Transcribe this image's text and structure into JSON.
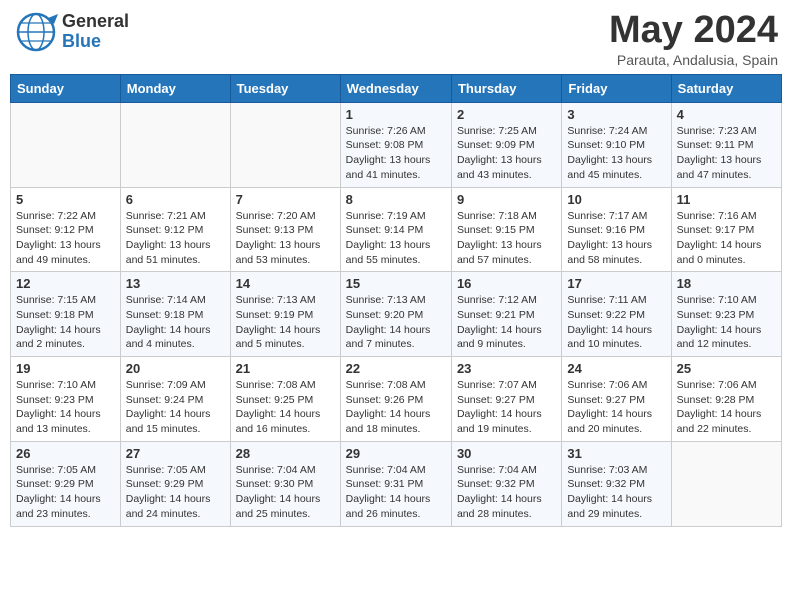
{
  "header": {
    "logo_general": "General",
    "logo_blue": "Blue",
    "month_title": "May 2024",
    "subtitle": "Parauta, Andalusia, Spain"
  },
  "weekdays": [
    "Sunday",
    "Monday",
    "Tuesday",
    "Wednesday",
    "Thursday",
    "Friday",
    "Saturday"
  ],
  "weeks": [
    [
      {
        "day": "",
        "info": ""
      },
      {
        "day": "",
        "info": ""
      },
      {
        "day": "",
        "info": ""
      },
      {
        "day": "1",
        "info": "Sunrise: 7:26 AM\nSunset: 9:08 PM\nDaylight: 13 hours\nand 41 minutes."
      },
      {
        "day": "2",
        "info": "Sunrise: 7:25 AM\nSunset: 9:09 PM\nDaylight: 13 hours\nand 43 minutes."
      },
      {
        "day": "3",
        "info": "Sunrise: 7:24 AM\nSunset: 9:10 PM\nDaylight: 13 hours\nand 45 minutes."
      },
      {
        "day": "4",
        "info": "Sunrise: 7:23 AM\nSunset: 9:11 PM\nDaylight: 13 hours\nand 47 minutes."
      }
    ],
    [
      {
        "day": "5",
        "info": "Sunrise: 7:22 AM\nSunset: 9:12 PM\nDaylight: 13 hours\nand 49 minutes."
      },
      {
        "day": "6",
        "info": "Sunrise: 7:21 AM\nSunset: 9:12 PM\nDaylight: 13 hours\nand 51 minutes."
      },
      {
        "day": "7",
        "info": "Sunrise: 7:20 AM\nSunset: 9:13 PM\nDaylight: 13 hours\nand 53 minutes."
      },
      {
        "day": "8",
        "info": "Sunrise: 7:19 AM\nSunset: 9:14 PM\nDaylight: 13 hours\nand 55 minutes."
      },
      {
        "day": "9",
        "info": "Sunrise: 7:18 AM\nSunset: 9:15 PM\nDaylight: 13 hours\nand 57 minutes."
      },
      {
        "day": "10",
        "info": "Sunrise: 7:17 AM\nSunset: 9:16 PM\nDaylight: 13 hours\nand 58 minutes."
      },
      {
        "day": "11",
        "info": "Sunrise: 7:16 AM\nSunset: 9:17 PM\nDaylight: 14 hours\nand 0 minutes."
      }
    ],
    [
      {
        "day": "12",
        "info": "Sunrise: 7:15 AM\nSunset: 9:18 PM\nDaylight: 14 hours\nand 2 minutes."
      },
      {
        "day": "13",
        "info": "Sunrise: 7:14 AM\nSunset: 9:18 PM\nDaylight: 14 hours\nand 4 minutes."
      },
      {
        "day": "14",
        "info": "Sunrise: 7:13 AM\nSunset: 9:19 PM\nDaylight: 14 hours\nand 5 minutes."
      },
      {
        "day": "15",
        "info": "Sunrise: 7:13 AM\nSunset: 9:20 PM\nDaylight: 14 hours\nand 7 minutes."
      },
      {
        "day": "16",
        "info": "Sunrise: 7:12 AM\nSunset: 9:21 PM\nDaylight: 14 hours\nand 9 minutes."
      },
      {
        "day": "17",
        "info": "Sunrise: 7:11 AM\nSunset: 9:22 PM\nDaylight: 14 hours\nand 10 minutes."
      },
      {
        "day": "18",
        "info": "Sunrise: 7:10 AM\nSunset: 9:23 PM\nDaylight: 14 hours\nand 12 minutes."
      }
    ],
    [
      {
        "day": "19",
        "info": "Sunrise: 7:10 AM\nSunset: 9:23 PM\nDaylight: 14 hours\nand 13 minutes."
      },
      {
        "day": "20",
        "info": "Sunrise: 7:09 AM\nSunset: 9:24 PM\nDaylight: 14 hours\nand 15 minutes."
      },
      {
        "day": "21",
        "info": "Sunrise: 7:08 AM\nSunset: 9:25 PM\nDaylight: 14 hours\nand 16 minutes."
      },
      {
        "day": "22",
        "info": "Sunrise: 7:08 AM\nSunset: 9:26 PM\nDaylight: 14 hours\nand 18 minutes."
      },
      {
        "day": "23",
        "info": "Sunrise: 7:07 AM\nSunset: 9:27 PM\nDaylight: 14 hours\nand 19 minutes."
      },
      {
        "day": "24",
        "info": "Sunrise: 7:06 AM\nSunset: 9:27 PM\nDaylight: 14 hours\nand 20 minutes."
      },
      {
        "day": "25",
        "info": "Sunrise: 7:06 AM\nSunset: 9:28 PM\nDaylight: 14 hours\nand 22 minutes."
      }
    ],
    [
      {
        "day": "26",
        "info": "Sunrise: 7:05 AM\nSunset: 9:29 PM\nDaylight: 14 hours\nand 23 minutes."
      },
      {
        "day": "27",
        "info": "Sunrise: 7:05 AM\nSunset: 9:29 PM\nDaylight: 14 hours\nand 24 minutes."
      },
      {
        "day": "28",
        "info": "Sunrise: 7:04 AM\nSunset: 9:30 PM\nDaylight: 14 hours\nand 25 minutes."
      },
      {
        "day": "29",
        "info": "Sunrise: 7:04 AM\nSunset: 9:31 PM\nDaylight: 14 hours\nand 26 minutes."
      },
      {
        "day": "30",
        "info": "Sunrise: 7:04 AM\nSunset: 9:32 PM\nDaylight: 14 hours\nand 28 minutes."
      },
      {
        "day": "31",
        "info": "Sunrise: 7:03 AM\nSunset: 9:32 PM\nDaylight: 14 hours\nand 29 minutes."
      },
      {
        "day": "",
        "info": ""
      }
    ]
  ]
}
